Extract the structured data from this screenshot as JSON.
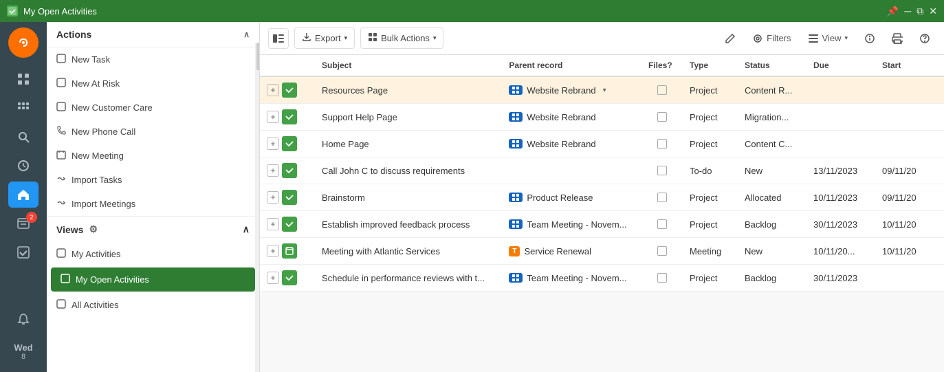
{
  "titleBar": {
    "title": "My Open Activities",
    "controls": [
      "pin",
      "minimize",
      "maximize",
      "close"
    ]
  },
  "iconSidebar": {
    "logo": "~",
    "items": [
      {
        "icon": "⊞",
        "name": "grid-icon",
        "active": false
      },
      {
        "icon": "⋯",
        "name": "dots-icon",
        "active": false
      },
      {
        "icon": "🔍",
        "name": "search-icon",
        "active": false
      },
      {
        "icon": "🕐",
        "name": "clock-icon",
        "active": false
      },
      {
        "icon": "🏠",
        "name": "home-icon",
        "active": true
      },
      {
        "icon": "≡",
        "name": "list-badge-icon",
        "active": false,
        "badge": "2"
      },
      {
        "icon": "✓",
        "name": "check-icon",
        "active": false
      }
    ],
    "bottomItems": [
      {
        "icon": "🔔",
        "name": "bell-icon"
      }
    ],
    "calendar": {
      "day": "Wed",
      "number": "8"
    }
  },
  "leftPanel": {
    "actionsSection": {
      "title": "Actions",
      "items": [
        {
          "label": "New Task",
          "icon": "☐",
          "name": "new-task"
        },
        {
          "label": "New At Risk",
          "icon": "☐",
          "name": "new-at-risk"
        },
        {
          "label": "New Customer Care",
          "icon": "☐",
          "name": "new-customer-care"
        },
        {
          "label": "New Phone Call",
          "icon": "📞",
          "name": "new-phone-call"
        },
        {
          "label": "New Meeting",
          "icon": "📅",
          "name": "new-meeting"
        },
        {
          "label": "Import Tasks",
          "icon": "↪",
          "name": "import-tasks"
        },
        {
          "label": "Import Meetings",
          "icon": "↪",
          "name": "import-meetings"
        }
      ]
    },
    "viewsSection": {
      "title": "Views",
      "items": [
        {
          "label": "My Activities",
          "icon": "☐",
          "name": "my-activities",
          "active": false
        },
        {
          "label": "My Open Activities",
          "icon": "☐",
          "name": "my-open-activities",
          "active": true
        },
        {
          "label": "All Activities",
          "icon": "☐",
          "name": "all-activities",
          "active": false
        }
      ]
    }
  },
  "toolbar": {
    "sidebarToggle": "▣",
    "exportLabel": "Export",
    "bulkActionsLabel": "Bulk Actions",
    "editIcon": "✏",
    "filtersLabel": "Filters",
    "viewLabel": "View",
    "infoIcon": "ⓘ",
    "printIcon": "🖨",
    "helpIcon": "❓"
  },
  "table": {
    "columns": [
      "",
      "Subject",
      "Parent record",
      "Files?",
      "Type",
      "Status",
      "Due",
      "Start"
    ],
    "rows": [
      {
        "highlighted": true,
        "addBtn": "+",
        "badgeType": "green",
        "badgeIcon": "✓",
        "subject": "Resources Page",
        "parentBadge": "blue",
        "parentBadgeIcon": "▦",
        "parentRecord": "Website Rebrand",
        "hasDropdown": true,
        "files": false,
        "type": "Project",
        "status": "Content R...",
        "due": "",
        "start": ""
      },
      {
        "highlighted": false,
        "addBtn": "+",
        "badgeType": "green",
        "badgeIcon": "✓",
        "subject": "Support Help Page",
        "parentBadge": "blue",
        "parentBadgeIcon": "▦",
        "parentRecord": "Website Rebrand",
        "hasDropdown": false,
        "files": false,
        "type": "Project",
        "status": "Migration...",
        "due": "",
        "start": ""
      },
      {
        "highlighted": false,
        "addBtn": "+",
        "badgeType": "green",
        "badgeIcon": "✓",
        "subject": "Home Page",
        "parentBadge": "blue",
        "parentBadgeIcon": "▦",
        "parentRecord": "Website Rebrand",
        "hasDropdown": false,
        "files": false,
        "type": "Project",
        "status": "Content C...",
        "due": "",
        "start": ""
      },
      {
        "highlighted": false,
        "addBtn": "+",
        "badgeType": "green",
        "badgeIcon": "✓",
        "subject": "Call John C to discuss requirements",
        "parentBadge": "",
        "parentBadgeIcon": "",
        "parentRecord": "",
        "hasDropdown": false,
        "files": false,
        "type": "To-do",
        "status": "New",
        "due": "13/11/2023",
        "start": "09/11/20"
      },
      {
        "highlighted": false,
        "addBtn": "+",
        "badgeType": "green",
        "badgeIcon": "✓",
        "subject": "Brainstorm",
        "parentBadge": "blue",
        "parentBadgeIcon": "▦",
        "parentRecord": "Product Release",
        "hasDropdown": false,
        "files": false,
        "type": "Project",
        "status": "Allocated",
        "due": "10/11/2023",
        "start": "09/11/20"
      },
      {
        "highlighted": false,
        "addBtn": "+",
        "badgeType": "green",
        "badgeIcon": "✓",
        "subject": "Establish improved feedback process",
        "parentBadge": "blue",
        "parentBadgeIcon": "▦",
        "parentRecord": "Team Meeting - Novem...",
        "hasDropdown": false,
        "files": false,
        "type": "Project",
        "status": "Backlog",
        "due": "30/11/2023",
        "start": "10/11/20"
      },
      {
        "highlighted": false,
        "addBtn": "+",
        "badgeType": "calendar",
        "badgeIcon": "📅",
        "subject": "Meeting with Atlantic Services",
        "parentBadge": "orange",
        "parentBadgeIcon": "T",
        "parentRecord": "Service Renewal",
        "hasDropdown": false,
        "files": false,
        "type": "Meeting",
        "status": "New",
        "due": "10/11/20...",
        "start": "10/11/20"
      },
      {
        "highlighted": false,
        "addBtn": "+",
        "badgeType": "green",
        "badgeIcon": "✓",
        "subject": "Schedule in performance reviews with t...",
        "parentBadge": "blue",
        "parentBadgeIcon": "▦",
        "parentRecord": "Team Meeting - Novem...",
        "hasDropdown": false,
        "files": false,
        "type": "Project",
        "status": "Backlog",
        "due": "30/11/2023",
        "start": ""
      }
    ]
  }
}
